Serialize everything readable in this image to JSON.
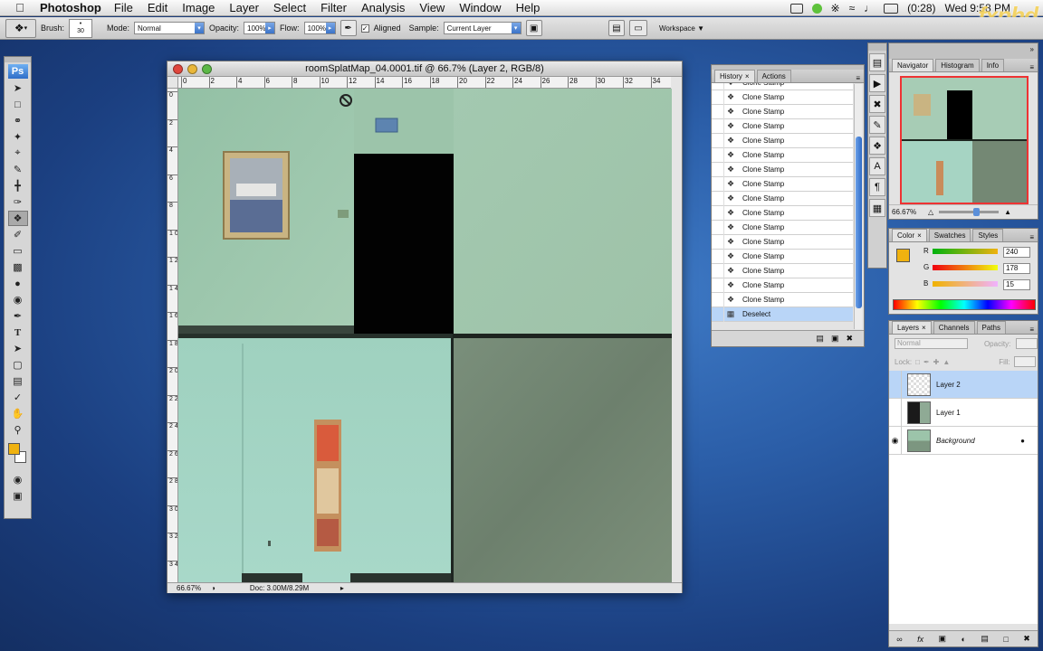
{
  "menubar": {
    "app": "Photoshop",
    "items": [
      "File",
      "Edit",
      "Image",
      "Layer",
      "Select",
      "Filter",
      "Analysis",
      "View",
      "Window",
      "Help"
    ],
    "battery": "(0:28)",
    "clock": "Wed 9:58 PM",
    "logo": "fxphd"
  },
  "options": {
    "brush_label": "Brush:",
    "brush_size": "30",
    "mode_label": "Mode:",
    "mode_value": "Normal",
    "opacity_label": "Opacity:",
    "opacity_value": "100%",
    "flow_label": "Flow:",
    "flow_value": "100%",
    "aligned_label": "Aligned",
    "sample_label": "Sample:",
    "sample_value": "Current Layer",
    "workspace_label": "Workspace"
  },
  "toolbox": {
    "ps_label": "Ps"
  },
  "document": {
    "title": "roomSplatMap_04.0001.tif @ 66.7% (Layer 2, RGB/8)",
    "zoom": "66.67%",
    "doc_info": "Doc: 3.00M/8.29M",
    "hruler": [
      "0",
      "2",
      "4",
      "6",
      "8",
      "10",
      "12",
      "14",
      "16",
      "18",
      "20",
      "22",
      "24",
      "26",
      "28",
      "30",
      "32",
      "34"
    ],
    "vruler": [
      "0",
      "2",
      "4",
      "6",
      "8",
      "1 0",
      "1 2",
      "1 4",
      "1 6",
      "1 8",
      "2 0",
      "2 2",
      "2 4",
      "2 6",
      "2 8",
      "3 0",
      "3 2",
      "3 4"
    ]
  },
  "history": {
    "tab_history": "History",
    "tab_actions": "Actions",
    "items": [
      "Clone Stamp",
      "Clone Stamp",
      "Clone Stamp",
      "Clone Stamp",
      "Clone Stamp",
      "Clone Stamp",
      "Clone Stamp",
      "Clone Stamp",
      "Clone Stamp",
      "Clone Stamp",
      "Clone Stamp",
      "Clone Stamp",
      "Clone Stamp",
      "Clone Stamp",
      "Clone Stamp",
      "Clone Stamp"
    ],
    "last": "Deselect"
  },
  "navigator": {
    "tab_navigator": "Navigator",
    "tab_histogram": "Histogram",
    "tab_info": "Info",
    "zoom": "66.67%"
  },
  "color": {
    "tab_color": "Color",
    "tab_swatches": "Swatches",
    "tab_styles": "Styles",
    "r_label": "R",
    "g_label": "G",
    "b_label": "B",
    "r": "240",
    "g": "178",
    "b": "15",
    "fg_hex": "#f0b20f"
  },
  "layers": {
    "tab_layers": "Layers",
    "tab_channels": "Channels",
    "tab_paths": "Paths",
    "blend": "Normal",
    "opacity_label": "Opacity:",
    "lock_label": "Lock:",
    "fill_label": "Fill:",
    "items": [
      {
        "name": "Layer 2"
      },
      {
        "name": "Layer 1"
      },
      {
        "name": "Background"
      }
    ]
  }
}
